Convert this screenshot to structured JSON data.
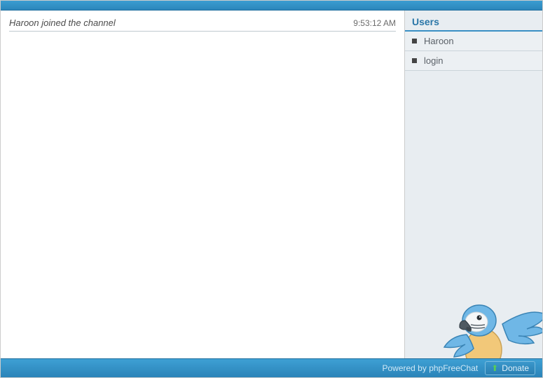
{
  "messages": [
    {
      "text": "Haroon joined the channel",
      "time": "9:53:12 AM"
    }
  ],
  "usersPanel": {
    "title": "Users",
    "list": [
      {
        "name": "Haroon"
      },
      {
        "name": "login"
      }
    ]
  },
  "footer": {
    "powered": "Powered by phpFreeChat",
    "donate": "Donate"
  }
}
